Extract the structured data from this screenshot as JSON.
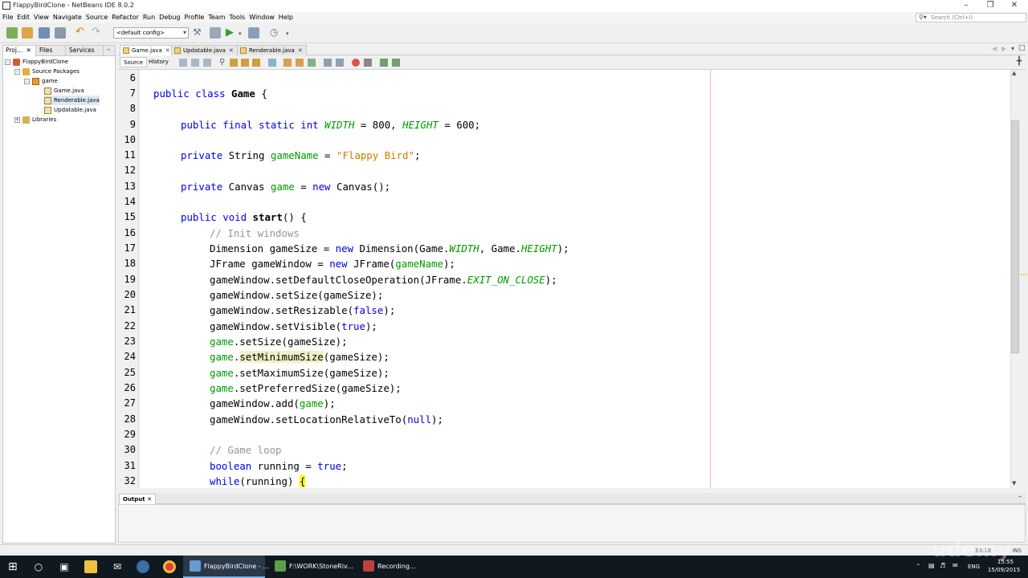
{
  "window": {
    "title": "FlappyBirdClone - NetBeans IDE 8.0.2"
  },
  "menu": [
    "File",
    "Edit",
    "View",
    "Navigate",
    "Source",
    "Refactor",
    "Run",
    "Debug",
    "Profile",
    "Team",
    "Tools",
    "Window",
    "Help"
  ],
  "search": {
    "placeholder": "Search (Ctrl+I)"
  },
  "toolbar": {
    "config": "<default config>"
  },
  "left_tabs": [
    "Proj...",
    "Files",
    "Services"
  ],
  "tree": {
    "project": "FlappyBirdClone",
    "source_packages": "Source Packages",
    "package": "game",
    "files": [
      "Game.java",
      "Renderable.java",
      "Updatable.java"
    ],
    "libraries": "Libraries"
  },
  "editor_tabs": [
    "Game.java",
    "Updatable.java",
    "Renderable.java"
  ],
  "source_tabs": {
    "source": "Source",
    "history": "History"
  },
  "line_numbers": [
    "6",
    "7",
    "8",
    "9",
    "10",
    "11",
    "12",
    "13",
    "14",
    "15",
    "16",
    "17",
    "18",
    "19",
    "20",
    "21",
    "22",
    "23",
    "24",
    "25",
    "26",
    "27",
    "28",
    "29",
    "30",
    "31",
    "32"
  ],
  "output": {
    "tab": "Output"
  },
  "status": {
    "position": "33:10",
    "mode": "INS"
  },
  "taskbar": {
    "apps": [
      "FlappyBirdClone - ...",
      "F:\\WORK\\StoneRiv...",
      "Recording..."
    ],
    "lang": "ENG",
    "time": "15:55",
    "date": "15/09/2015"
  },
  "watermark": "udemy",
  "colors": {
    "keyword": "#0000e6",
    "field": "#009900",
    "string": "#ce7b00",
    "comment": "#969696"
  }
}
